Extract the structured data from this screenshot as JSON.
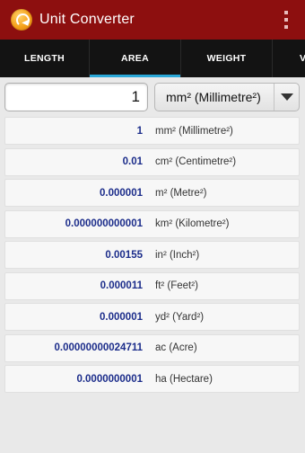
{
  "app": {
    "title": "Unit Converter"
  },
  "tabs": [
    {
      "label": "LENGTH"
    },
    {
      "label": "AREA",
      "active": true
    },
    {
      "label": "WEIGHT"
    },
    {
      "label": "V"
    }
  ],
  "input": {
    "value": "1"
  },
  "unit_select": {
    "selected": "mm² (Millimetre²)"
  },
  "results": [
    {
      "value": "1",
      "unit": "mm² (Millimetre²)"
    },
    {
      "value": "0.01",
      "unit": "cm² (Centimetre²)"
    },
    {
      "value": "0.000001",
      "unit": "m² (Metre²)"
    },
    {
      "value": "0.000000000001",
      "unit": "km² (Kilometre²)"
    },
    {
      "value": "0.00155",
      "unit": "in² (Inch²)"
    },
    {
      "value": "0.000011",
      "unit": "ft² (Feet²)"
    },
    {
      "value": "0.000001",
      "unit": "yd² (Yard²)"
    },
    {
      "value": "0.00000000024711",
      "unit": "ac (Acre)"
    },
    {
      "value": "0.0000000001",
      "unit": "ha (Hectare)"
    }
  ],
  "colors": {
    "appbar": "#8d0f0f",
    "tabbar": "#131313",
    "tab_indicator": "#2aa8d8",
    "value_text": "#1b2c8a"
  },
  "icons": {
    "app": "unit-converter-logo-icon",
    "menu": "overflow-menu-icon",
    "dropdown": "dropdown-arrow-icon"
  }
}
